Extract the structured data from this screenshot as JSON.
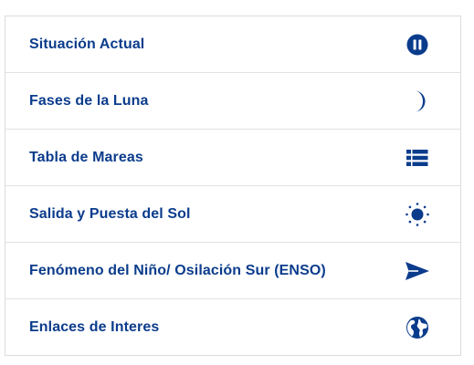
{
  "colors": {
    "accent": "#0b3c8c",
    "border": "#dcdcdc"
  },
  "menu": {
    "items": [
      {
        "label": "Situación Actual",
        "icon": "pause-circle-icon"
      },
      {
        "label": "Fases de la Luna",
        "icon": "moon-icon"
      },
      {
        "label": "Tabla de Mareas",
        "icon": "list-icon"
      },
      {
        "label": "Salida y Puesta del Sol",
        "icon": "sun-icon"
      },
      {
        "label": "Fenómeno del Niño/ Osilación Sur (ENSO)",
        "icon": "send-arrow-icon"
      },
      {
        "label": "Enlaces de Interes",
        "icon": "globe-icon"
      }
    ]
  }
}
